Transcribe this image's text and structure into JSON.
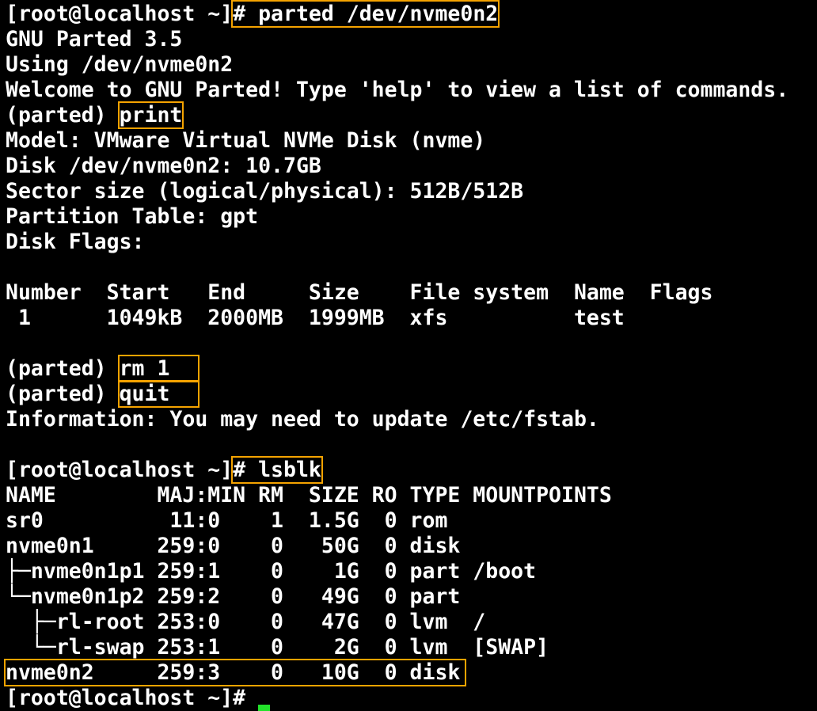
{
  "colors": {
    "background": "#000000",
    "text": "#ffffff",
    "highlight_box": "#f5a300",
    "cursor": "#22e22a"
  },
  "terminal": {
    "session1": {
      "prompt": "[root@localhost ~]",
      "command": "# parted /dev/nvme0n2",
      "banner": [
        "GNU Parted 3.5",
        "Using /dev/nvme0n2",
        "Welcome to GNU Parted! Type 'help' to view a list of commands."
      ],
      "parted_prompt": "(parted) ",
      "print_command": "print",
      "disk_info": [
        "Model: VMware Virtual NVMe Disk (nvme)",
        "Disk /dev/nvme0n2: 10.7GB",
        "Sector size (logical/physical): 512B/512B",
        "Partition Table: gpt",
        "Disk Flags:"
      ],
      "partition_header": "Number  Start   End     Size    File system  Name  Flags",
      "partition_rows": [
        " 1      1049kB  2000MB  1999MB  xfs          test"
      ],
      "rm_command": "rm 1",
      "quit_command": "quit",
      "info_message": "Information: You may need to update /etc/fstab."
    },
    "session2": {
      "prompt": "[root@localhost ~]",
      "command": "# lsblk",
      "lsblk_header": "NAME        MAJ:MIN RM  SIZE RO TYPE MOUNTPOINTS",
      "lsblk_rows": [
        "sr0          11:0    1  1.5G  0 rom",
        "nvme0n1     259:0    0   50G  0 disk",
        "├─nvme0n1p1 259:1    0    1G  0 part /boot",
        "└─nvme0n1p2 259:2    0   49G  0 part",
        "  ├─rl-root 253:0    0   47G  0 lvm  /",
        "  └─rl-swap 253:1    0    2G  0 lvm  [SWAP]"
      ],
      "highlighted_row": "nvme0n2     259:3    0   10G  0 disk"
    },
    "final_prompt": "[root@localhost ~]# "
  }
}
